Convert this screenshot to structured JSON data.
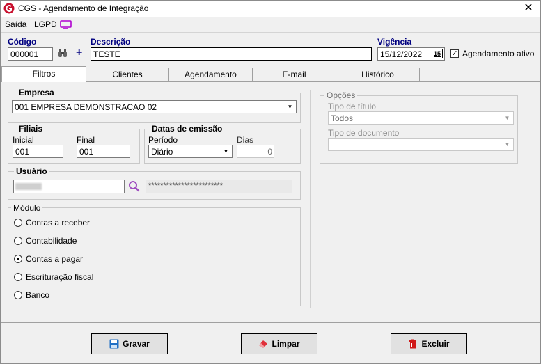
{
  "window": {
    "title": "CGS - Agendamento de Integração",
    "close_glyph": "✕"
  },
  "menu": {
    "items": [
      "Saída",
      "LGPD"
    ]
  },
  "header": {
    "codigo_label": "Código",
    "codigo_value": "000001",
    "descricao_label": "Descrição",
    "descricao_value": "TESTE",
    "vigencia_label": "Vigência",
    "vigencia_value": "15/12/2022",
    "calendar_day": "15",
    "agendamento_ativo_label": "Agendamento ativo",
    "agendamento_ativo_checked": true
  },
  "tabs": [
    "Filtros",
    "Clientes",
    "Agendamento",
    "E-mail",
    "Histórico"
  ],
  "filtros": {
    "empresa_label": "Empresa",
    "empresa_value": "001 EMPRESA DEMONSTRACAO 02",
    "filiais_label": "Filiais",
    "inicial_label": "Inicial",
    "inicial_value": "001",
    "final_label": "Final",
    "final_value": "001",
    "datas_label": "Datas de emissão",
    "periodo_label": "Período",
    "periodo_value": "Diário",
    "dias_label": "Dias",
    "dias_value": "0",
    "usuario_label": "Usuário",
    "usuario_value": "",
    "usuario_mask": "*************************",
    "modulo_label": "Módulo",
    "modulos": [
      {
        "label": "Contas a receber",
        "checked": false
      },
      {
        "label": "Contabilidade",
        "checked": false
      },
      {
        "label": "Contas a pagar",
        "checked": true
      },
      {
        "label": "Escrituração fiscal",
        "checked": false
      },
      {
        "label": "Banco",
        "checked": false
      }
    ],
    "opcoes_label": "Opções",
    "tipo_titulo_label": "Tipo de título",
    "tipo_titulo_value": "Todos",
    "tipo_documento_label": "Tipo de documento",
    "tipo_documento_value": ""
  },
  "buttons": {
    "gravar": "Gravar",
    "limpar": "Limpar",
    "excluir": "Excluir"
  },
  "colors": {
    "header_label": "#000080",
    "accent_red": "#cc0000",
    "lgpd_icon": "#b000d0"
  }
}
